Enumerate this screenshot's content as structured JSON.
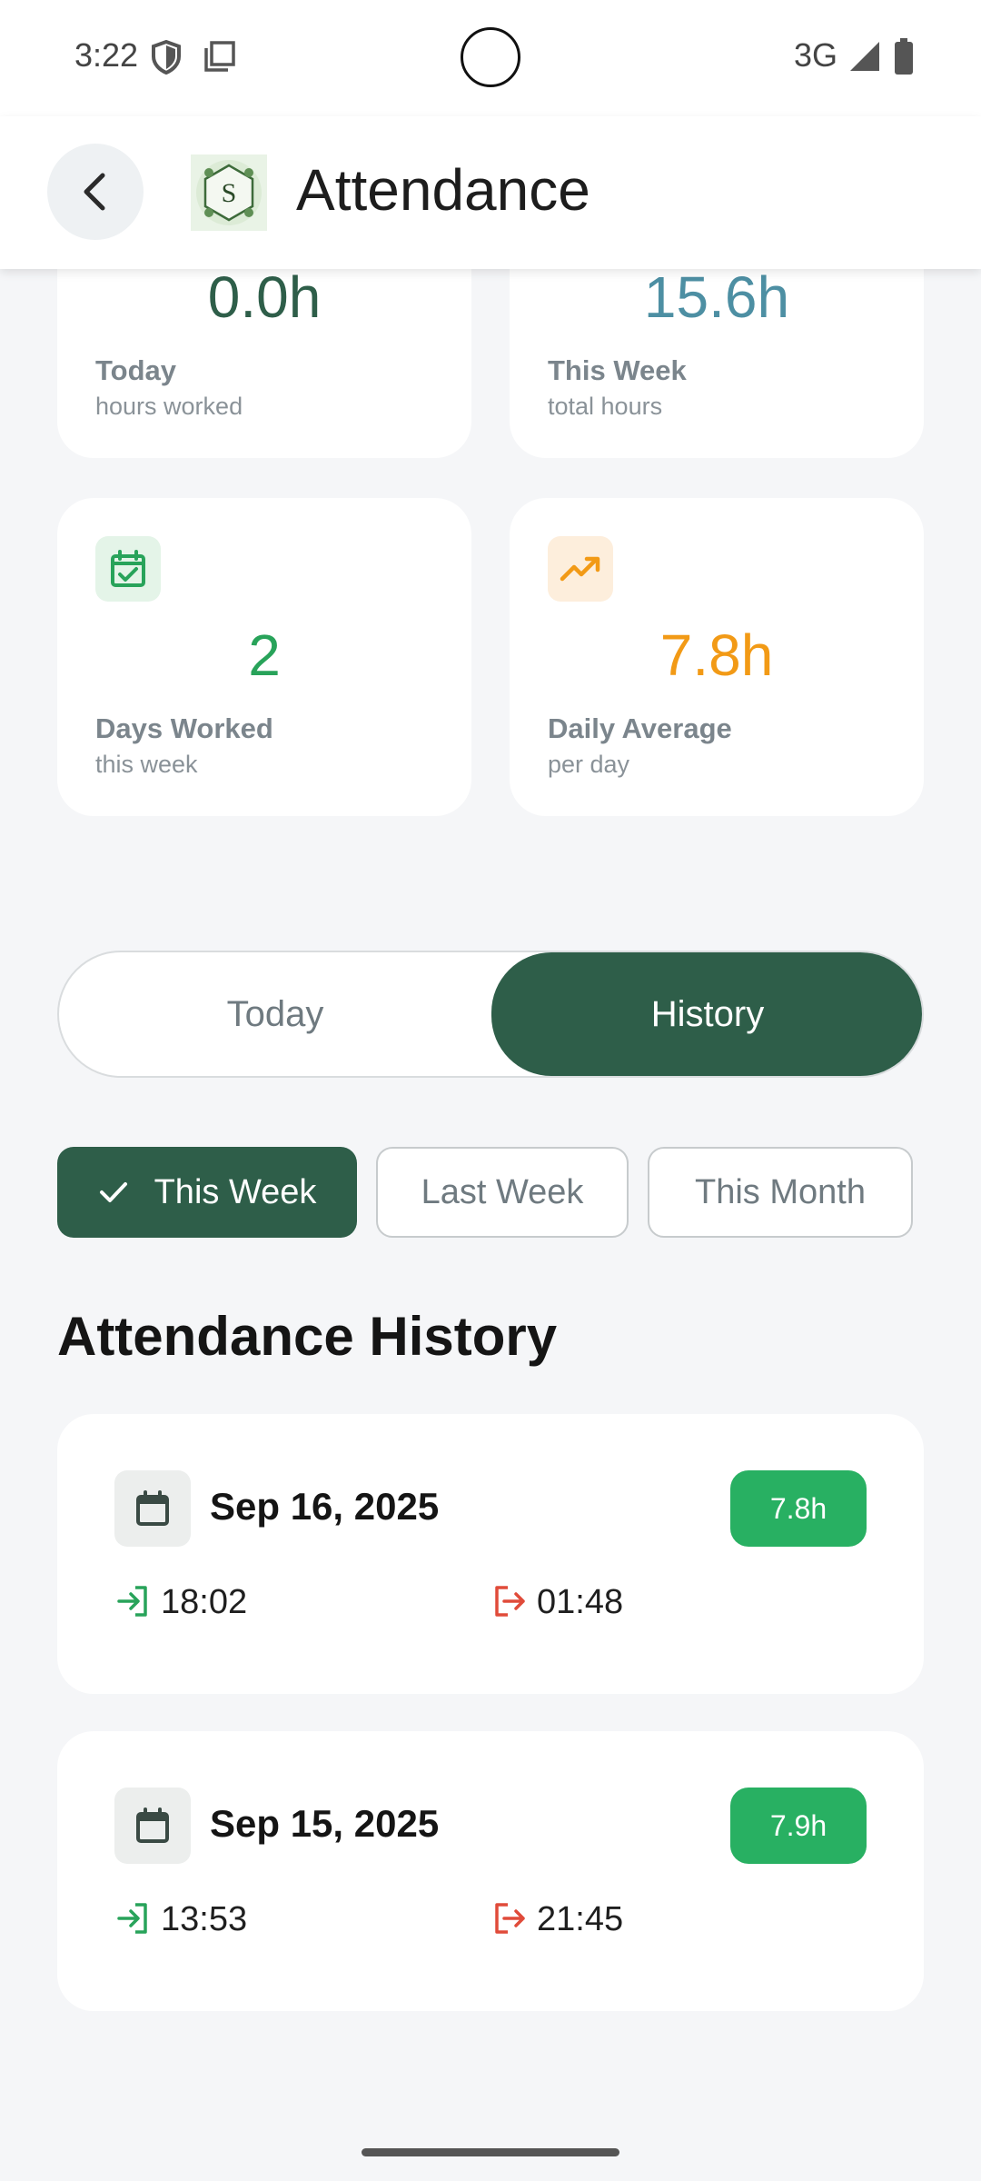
{
  "status_bar": {
    "time": "3:22",
    "network": "3G",
    "icons": [
      "shield-icon",
      "screenshot-icon",
      "signal-icon",
      "battery-icon"
    ]
  },
  "app_bar": {
    "title": "Attendance",
    "back_icon": "arrow-left-icon",
    "logo_letter": "S"
  },
  "stats": {
    "today": {
      "value": "0.0h",
      "label": "Today",
      "sub": "hours worked",
      "color": "#2e5e49"
    },
    "this_week": {
      "value": "15.6h",
      "label": "This Week",
      "sub": "total hours",
      "color": "#4d8fa3"
    },
    "days_worked": {
      "value": "2",
      "label": "Days Worked",
      "sub": "this week",
      "color": "#28a35a",
      "icon": "calendar-check-icon"
    },
    "daily_average": {
      "value": "7.8h",
      "label": "Daily Average",
      "sub": "per day",
      "color": "#f29a16",
      "icon": "trending-up-icon"
    }
  },
  "tabs": {
    "today": "Today",
    "history": "History",
    "active": "History"
  },
  "filters": {
    "this_week": "This Week",
    "last_week": "Last Week",
    "this_month": "This Month",
    "selected": "This Week"
  },
  "history": {
    "title": "Attendance History",
    "entries": [
      {
        "date": "Sep 16, 2025",
        "hours": "7.8h",
        "check_in": "18:02",
        "check_out": "01:48"
      },
      {
        "date": "Sep 15, 2025",
        "hours": "7.9h",
        "check_in": "13:53",
        "check_out": "21:45"
      }
    ]
  },
  "colors": {
    "primary": "#2e5e49",
    "badge_green": "#28b062",
    "check_in": "#28a35a",
    "check_out": "#e04b3a"
  }
}
